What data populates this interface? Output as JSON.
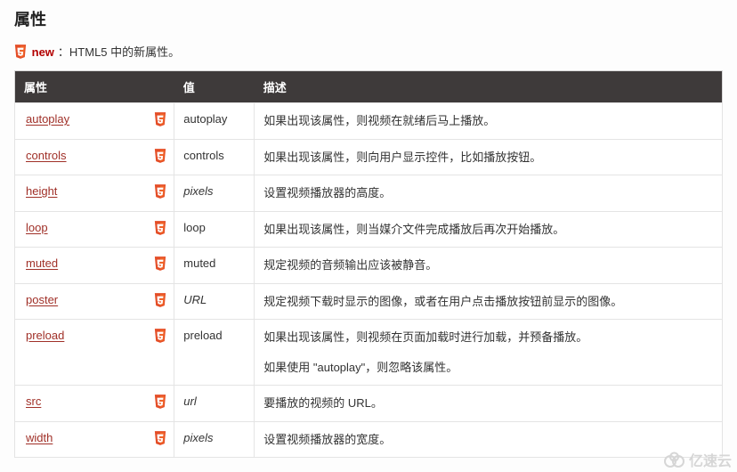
{
  "section_title": "属性",
  "intro": {
    "new_keyword": "new",
    "text_after": "：HTML5 中的新属性。"
  },
  "table": {
    "headers": {
      "attr": "属性",
      "value": "值",
      "desc": "描述"
    },
    "rows": [
      {
        "attr": "autoplay",
        "value": "autoplay",
        "value_italic": false,
        "desc": [
          "如果出现该属性，则视频在就绪后马上播放。"
        ]
      },
      {
        "attr": "controls",
        "value": "controls",
        "value_italic": false,
        "desc": [
          "如果出现该属性，则向用户显示控件，比如播放按钮。"
        ]
      },
      {
        "attr": "height",
        "value": "pixels",
        "value_italic": true,
        "desc": [
          "设置视频播放器的高度。"
        ]
      },
      {
        "attr": "loop",
        "value": "loop",
        "value_italic": false,
        "desc": [
          "如果出现该属性，则当媒介文件完成播放后再次开始播放。"
        ]
      },
      {
        "attr": "muted",
        "value": "muted",
        "value_italic": false,
        "desc": [
          "规定视频的音频输出应该被静音。"
        ]
      },
      {
        "attr": "poster",
        "value": "URL",
        "value_italic": true,
        "desc": [
          "规定视频下载时显示的图像，或者在用户点击播放按钮前显示的图像。"
        ]
      },
      {
        "attr": "preload",
        "value": "preload",
        "value_italic": false,
        "desc": [
          "如果出现该属性，则视频在页面加载时进行加载，并预备播放。",
          "如果使用 \"autoplay\"，则忽略该属性。"
        ]
      },
      {
        "attr": "src",
        "value": "url",
        "value_italic": true,
        "desc": [
          "要播放的视频的 URL。"
        ]
      },
      {
        "attr": "width",
        "value": "pixels",
        "value_italic": true,
        "desc": [
          "设置视频播放器的宽度。"
        ]
      }
    ]
  },
  "watermark": "亿速云"
}
